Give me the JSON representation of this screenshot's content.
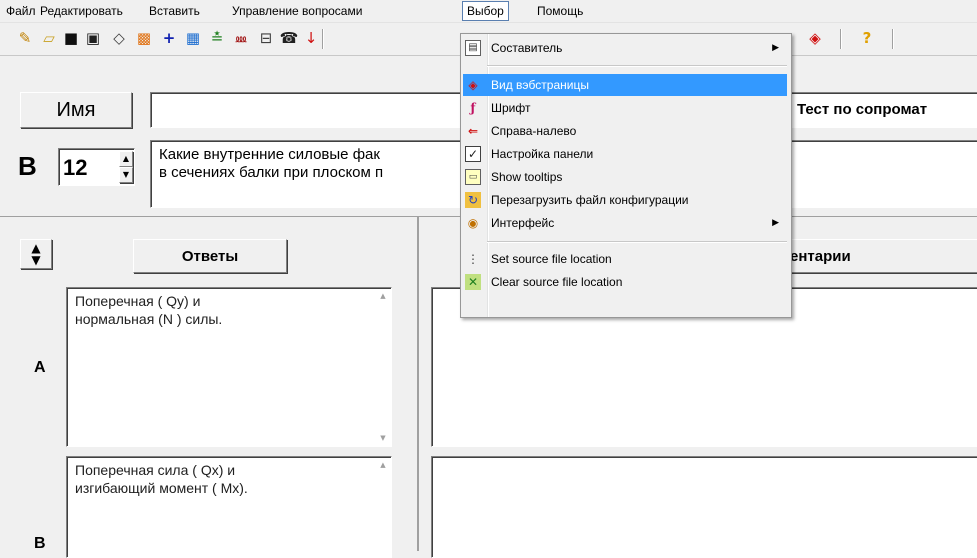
{
  "menubar": {
    "items": [
      "Файл",
      "Редактировать",
      "Вставить",
      "Управление вопросами",
      "Выбор",
      "Помощь"
    ]
  },
  "toolbar": {
    "icons": [
      "new-file-icon",
      "open-folder-icon",
      "save-icon",
      "save-as-icon",
      "eraser-icon",
      "frame-icon",
      "add-icon",
      "pattern-icon",
      "sort-icon",
      "score-icon",
      "print-icon",
      "phone-icon",
      "arrow-down-icon",
      "web-view-icon",
      "help-icon"
    ],
    "help_glyph": "?"
  },
  "question": {
    "name_label": "Имя",
    "name_value": "",
    "test_title": "Тест по сопромат",
    "number_label": "В",
    "number_value": "12",
    "text_line1": "Какие внутренние силовые фак",
    "text_line2": "в сечениях балки при плоском п"
  },
  "answers": {
    "header": "Ответы",
    "comments_header": "ентарии",
    "items": [
      {
        "letter": "A",
        "line1": "Поперечная ( Qy) и",
        "line2": "нормальная (N ) силы."
      },
      {
        "letter": "B",
        "line1": "Поперечная сила ( Qx) и",
        "line2": "изгибающий момент ( Mx)."
      }
    ]
  },
  "dropdown": {
    "items": [
      {
        "label": "Составитель",
        "icon": "composer-icon",
        "submenu": true
      },
      {
        "label": "Вид вэбстраницы",
        "icon": "web-view-icon",
        "highlighted": true
      },
      {
        "label": "Шрифт",
        "icon": "font-icon"
      },
      {
        "label": "Справа-налево",
        "icon": "rtl-icon"
      },
      {
        "label": "Настройка панели",
        "icon": "panel-settings-icon"
      },
      {
        "label": "Show tooltips",
        "icon": "tooltip-icon"
      },
      {
        "label": "Перезагрузить файл конфигурации",
        "icon": "reload-config-icon"
      },
      {
        "label": "Интерфейс",
        "icon": "interface-icon",
        "submenu": true
      },
      {
        "label": "Set source file location",
        "icon": "source-location-icon"
      },
      {
        "label": "Clear source file location",
        "icon": "clear-location-icon"
      }
    ]
  }
}
